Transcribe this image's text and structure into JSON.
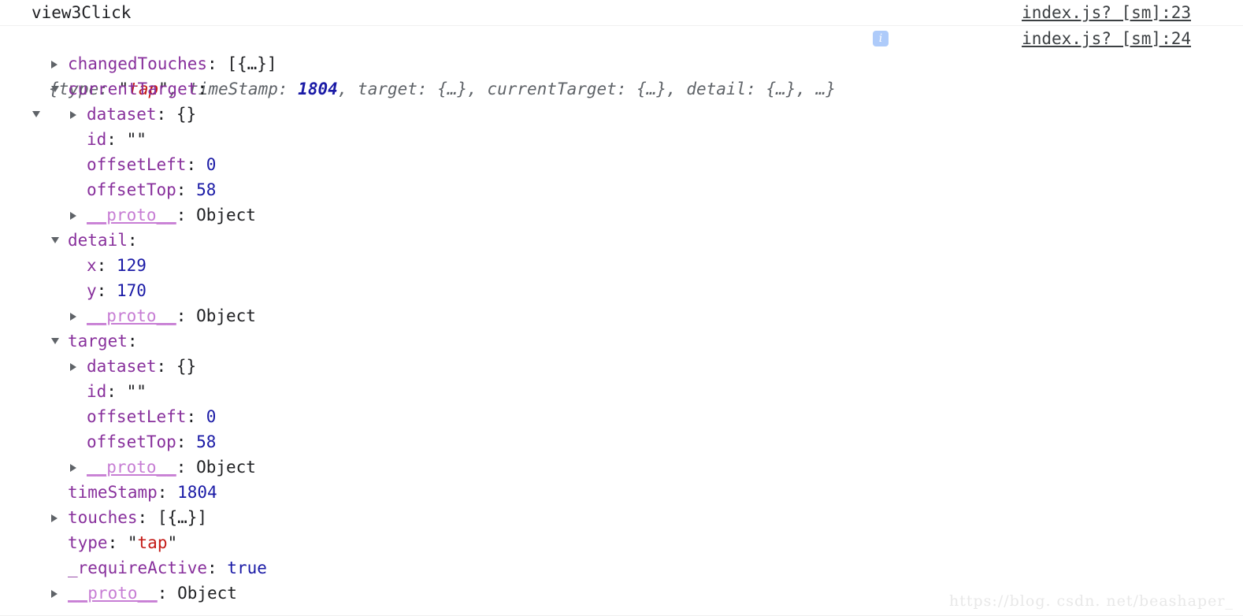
{
  "console": {
    "header": {
      "label": "view3Click",
      "source_link": "index.js? [sm]:23"
    },
    "object_entry": {
      "source_link": "index.js? [sm]:24",
      "summary": {
        "open_brace": "{",
        "parts": [
          {
            "key": "type",
            "sep": ": ",
            "value": "\"tap\"",
            "kind": "string",
            "after": ", "
          },
          {
            "key": "timeStamp",
            "sep": ": ",
            "value": "1804",
            "kind": "number",
            "after": ", "
          },
          {
            "key": "target",
            "sep": ": ",
            "value": "{…}",
            "kind": "object",
            "after": ", "
          },
          {
            "key": "currentTarget",
            "sep": ": ",
            "value": "{…}",
            "kind": "object",
            "after": ", "
          },
          {
            "key": "detail",
            "sep": ": ",
            "value": "{…}",
            "kind": "object",
            "after": ", "
          }
        ],
        "ellipsis": "…",
        "close_brace": "}",
        "info_badge": "i",
        "expanded": true
      },
      "rows": [
        {
          "indent": 1,
          "twisty": "collapsed",
          "key": "changedTouches",
          "sep": ": ",
          "value": "[{…}]",
          "kind": "object"
        },
        {
          "indent": 1,
          "twisty": "expanded",
          "key": "currentTarget",
          "sep": ":",
          "value": "",
          "kind": "none"
        },
        {
          "indent": 2,
          "twisty": "collapsed",
          "key": "dataset",
          "sep": ": ",
          "value": "{}",
          "kind": "object"
        },
        {
          "indent": 2,
          "twisty": "none",
          "key": "id",
          "sep": ": ",
          "value": "\"\"",
          "kind": "emptystring"
        },
        {
          "indent": 2,
          "twisty": "none",
          "key": "offsetLeft",
          "sep": ": ",
          "value": "0",
          "kind": "number"
        },
        {
          "indent": 2,
          "twisty": "none",
          "key": "offsetTop",
          "sep": ": ",
          "value": "58",
          "kind": "number"
        },
        {
          "indent": 2,
          "twisty": "collapsed",
          "key": "__proto__",
          "sep": ": ",
          "value": "Object",
          "kind": "proto"
        },
        {
          "indent": 1,
          "twisty": "expanded",
          "key": "detail",
          "sep": ":",
          "value": "",
          "kind": "none"
        },
        {
          "indent": 2,
          "twisty": "none",
          "key": "x",
          "sep": ": ",
          "value": "129",
          "kind": "number"
        },
        {
          "indent": 2,
          "twisty": "none",
          "key": "y",
          "sep": ": ",
          "value": "170",
          "kind": "number"
        },
        {
          "indent": 2,
          "twisty": "collapsed",
          "key": "__proto__",
          "sep": ": ",
          "value": "Object",
          "kind": "proto"
        },
        {
          "indent": 1,
          "twisty": "expanded",
          "key": "target",
          "sep": ":",
          "value": "",
          "kind": "none"
        },
        {
          "indent": 2,
          "twisty": "collapsed",
          "key": "dataset",
          "sep": ": ",
          "value": "{}",
          "kind": "object"
        },
        {
          "indent": 2,
          "twisty": "none",
          "key": "id",
          "sep": ": ",
          "value": "\"\"",
          "kind": "emptystring"
        },
        {
          "indent": 2,
          "twisty": "none",
          "key": "offsetLeft",
          "sep": ": ",
          "value": "0",
          "kind": "number"
        },
        {
          "indent": 2,
          "twisty": "none",
          "key": "offsetTop",
          "sep": ": ",
          "value": "58",
          "kind": "number"
        },
        {
          "indent": 2,
          "twisty": "collapsed",
          "key": "__proto__",
          "sep": ": ",
          "value": "Object",
          "kind": "proto"
        },
        {
          "indent": 1,
          "twisty": "none",
          "key": "timeStamp",
          "sep": ": ",
          "value": "1804",
          "kind": "number"
        },
        {
          "indent": 1,
          "twisty": "collapsed",
          "key": "touches",
          "sep": ": ",
          "value": "[{…}]",
          "kind": "object"
        },
        {
          "indent": 1,
          "twisty": "none",
          "key": "type",
          "sep": ": ",
          "value": "\"tap\"",
          "kind": "string"
        },
        {
          "indent": 1,
          "twisty": "none",
          "key": "_requireActive",
          "sep": ": ",
          "value": "true",
          "kind": "boolean"
        },
        {
          "indent": 1,
          "twisty": "collapsed",
          "key": "__proto__",
          "sep": ": ",
          "value": "Object",
          "kind": "proto"
        }
      ]
    }
  },
  "watermark": "https://blog. csdn. net/beashaper_",
  "colors": {
    "property": "#88309c",
    "proto": "#c77dd4",
    "number": "#1a1aa6",
    "string": "#c41a16",
    "plain": "#202124",
    "summary": "#5f6368",
    "link": "#3c4043",
    "info_badge_bg": "#aecbfa",
    "separator": "#f0f0f0",
    "watermark": "#e8e8e8"
  }
}
